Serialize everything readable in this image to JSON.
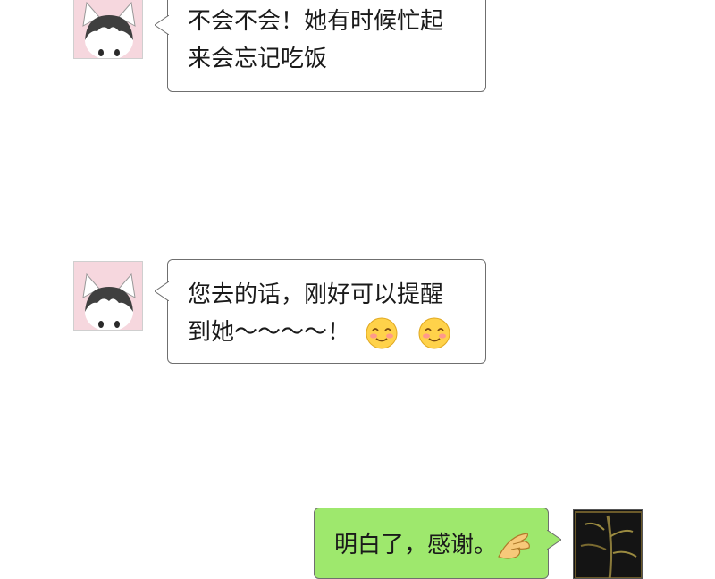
{
  "chat": {
    "messages": [
      {
        "sender": "friend",
        "lines": [
          "不会不会！她有时候忙起",
          "来会忘记吃饭"
        ]
      },
      {
        "sender": "friend",
        "lines": [
          "您去的话，刚好可以提醒",
          "到她～～～～！"
        ],
        "emoji": [
          "smiling-blush-icon",
          "smiling-blush-icon"
        ]
      },
      {
        "sender": "me",
        "lines": [
          "明白了，感谢。"
        ],
        "emoji": [
          "pointing-hand-icon"
        ]
      }
    ]
  },
  "colors": {
    "incoming_bubble": "#ffffff",
    "outgoing_bubble": "#9ee86d",
    "bubble_border": "#6f6f6f",
    "avatar_bg": "#f6d7de"
  }
}
